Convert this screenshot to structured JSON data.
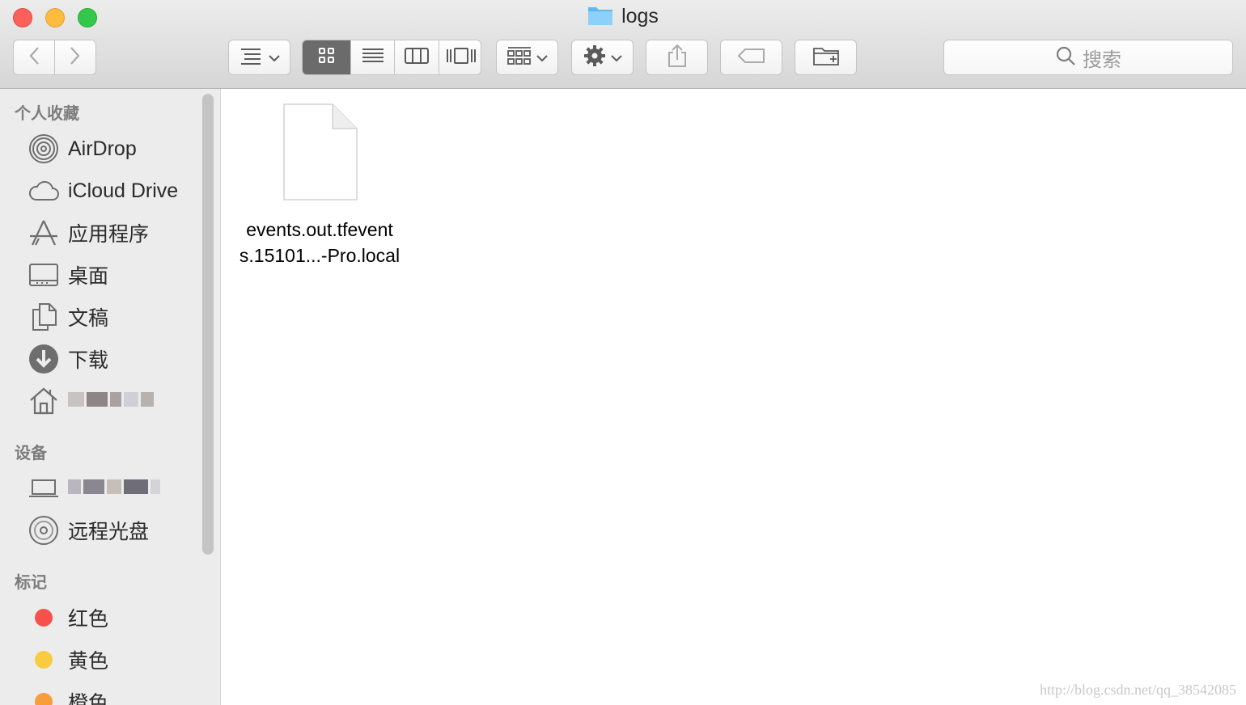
{
  "window": {
    "title": "logs"
  },
  "toolbar": {
    "search_placeholder": "搜索",
    "view_modes": [
      "icon-view",
      "list-view",
      "column-view",
      "cover-flow-view"
    ],
    "active_view": "icon-view"
  },
  "sidebar": {
    "favorites_header": "个人收藏",
    "favorites": [
      {
        "label": "AirDrop",
        "icon": "airdrop-icon"
      },
      {
        "label": "iCloud Drive",
        "icon": "cloud-icon"
      },
      {
        "label": "应用程序",
        "icon": "applications-icon"
      },
      {
        "label": "桌面",
        "icon": "desktop-icon"
      },
      {
        "label": "文稿",
        "icon": "documents-icon"
      },
      {
        "label": "下载",
        "icon": "download-icon"
      }
    ],
    "devices_header": "设备",
    "devices": [
      {
        "label": "远程光盘",
        "icon": "disc-icon"
      }
    ],
    "tags_header": "标记",
    "tags": [
      {
        "label": "红色",
        "color": "#f6524b"
      },
      {
        "label": "黄色",
        "color": "#f8cc3e"
      },
      {
        "label": "橙色",
        "color": "#f99d3a"
      }
    ]
  },
  "content": {
    "files": [
      {
        "name_line1": "events.out.tfevent",
        "name_line2": "s.15101...-Pro.local"
      }
    ]
  },
  "watermark": "http://blog.csdn.net/qq_38542085"
}
